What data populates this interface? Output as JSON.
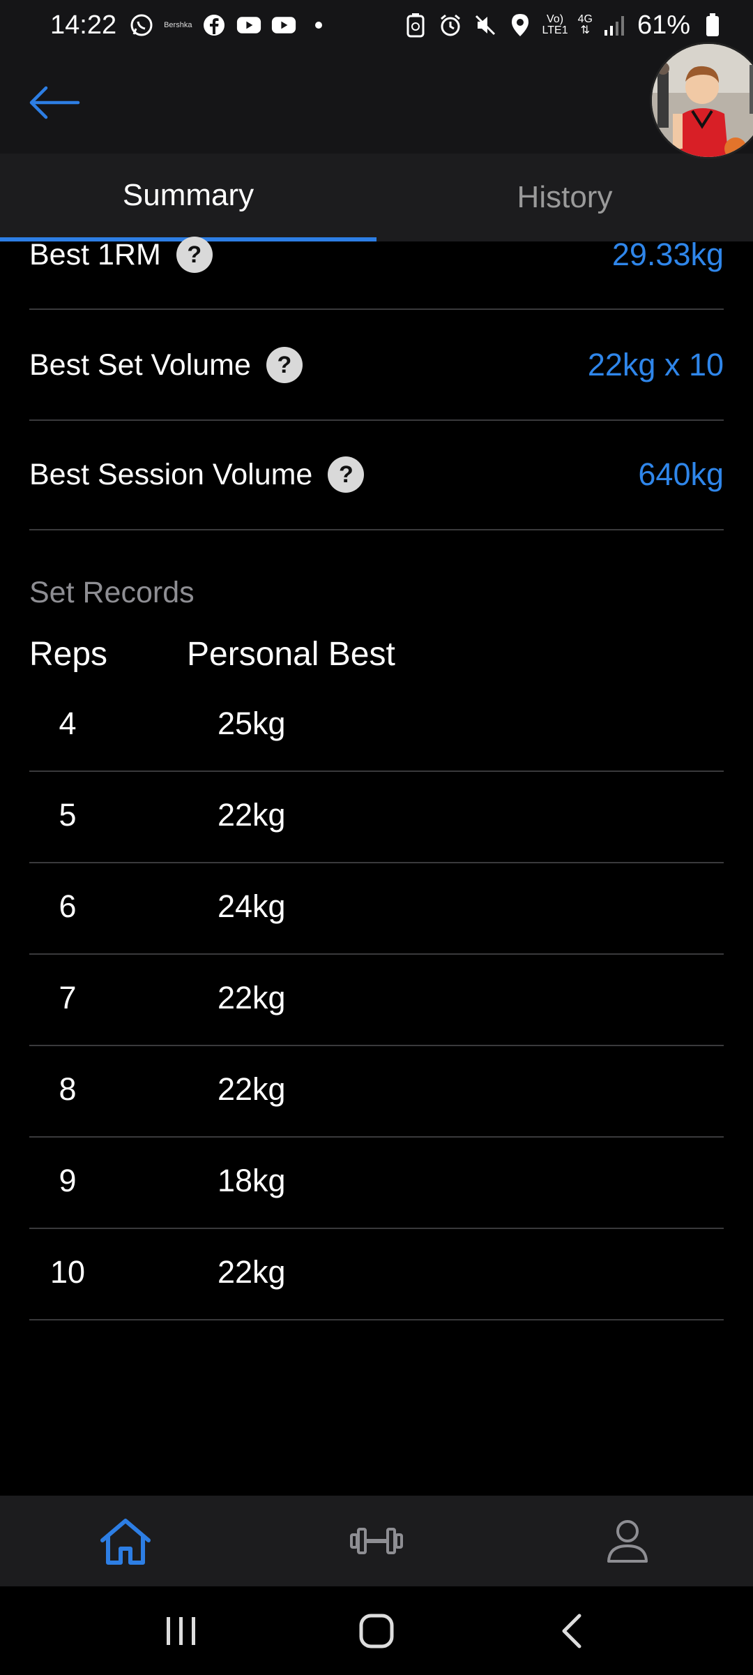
{
  "status_bar": {
    "time": "14:22",
    "brand_text": "Bershka",
    "battery": "61%",
    "network_top": "Vo)",
    "network_bottom": "LTE1",
    "network_gen": "4G"
  },
  "header": {
    "back_icon": "arrow-left-icon",
    "accent_color": "#2d7ee4"
  },
  "tabs": [
    {
      "label": "Summary",
      "active": true
    },
    {
      "label": "History",
      "active": false
    }
  ],
  "stats": [
    {
      "label": "Best 1RM",
      "value": "29.33kg"
    },
    {
      "label": "Best Set Volume",
      "value": "22kg x 10"
    },
    {
      "label": "Best Session Volume",
      "value": "640kg"
    }
  ],
  "set_records": {
    "title": "Set Records",
    "col_reps": "Reps",
    "col_pb": "Personal Best",
    "rows": [
      {
        "reps": "4",
        "pb": "25kg"
      },
      {
        "reps": "5",
        "pb": "22kg"
      },
      {
        "reps": "6",
        "pb": "24kg"
      },
      {
        "reps": "7",
        "pb": "22kg"
      },
      {
        "reps": "8",
        "pb": "22kg"
      },
      {
        "reps": "9",
        "pb": "18kg"
      },
      {
        "reps": "10",
        "pb": "22kg"
      }
    ]
  },
  "bottom_nav": [
    {
      "icon": "home-icon",
      "active": true
    },
    {
      "icon": "dumbbell-icon",
      "active": false
    },
    {
      "icon": "profile-icon",
      "active": false
    }
  ],
  "help_symbol": "?"
}
